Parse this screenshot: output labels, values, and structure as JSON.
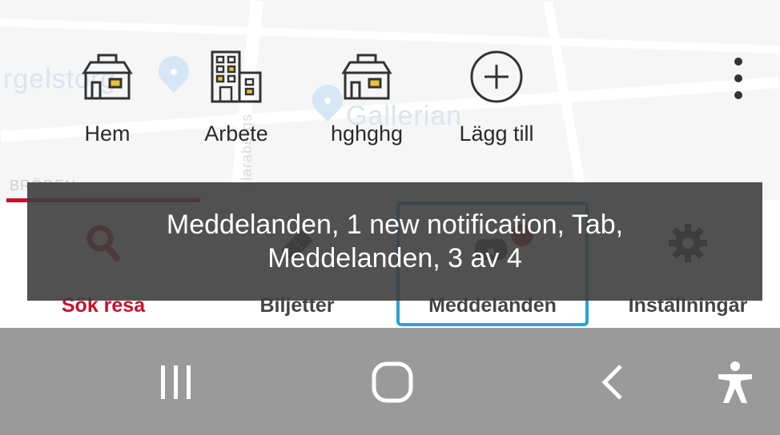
{
  "map": {
    "labels": [
      "rgelstorg",
      "Gallerian",
      "Klarabergs",
      "BRÖDEN"
    ]
  },
  "favorites": [
    {
      "label": "Hem",
      "icon": "house-icon"
    },
    {
      "label": "Arbete",
      "icon": "office-building-icon"
    },
    {
      "label": "hghghg",
      "icon": "house-icon"
    },
    {
      "label": "Lägg till",
      "icon": "add-circle-icon"
    }
  ],
  "more_menu": {
    "icon": "more-vertical-icon"
  },
  "bottom_nav": {
    "items": [
      {
        "label": "Sök resa",
        "icon": "search-icon",
        "active": true
      },
      {
        "label": "Biljetter",
        "icon": "ticket-icon",
        "active": false
      },
      {
        "label": "Meddelanden",
        "icon": "messages-icon",
        "active": false,
        "badge": true
      },
      {
        "label": "Inställningar",
        "icon": "gear-icon",
        "active": false
      }
    ]
  },
  "screen_reader": {
    "line1": "Meddelanden, 1 new notification, Tab,",
    "line2": "Meddelanden, 3 av 4"
  },
  "system_bar": {
    "buttons": [
      "recents-icon",
      "home-icon",
      "back-icon",
      "accessibility-icon"
    ]
  },
  "colors": {
    "accent": "#c8102e",
    "focus": "#2aa3d0",
    "overlay": "#3e3e3e",
    "system_bar": "#9a9a9a"
  }
}
